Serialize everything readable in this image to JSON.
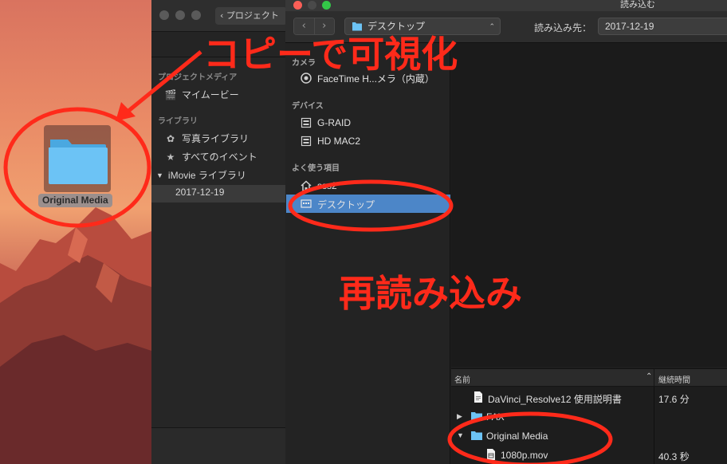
{
  "desktop": {
    "folder_label": "Original Media"
  },
  "imovie": {
    "back_button_label": "プロジェクト",
    "sections": [
      {
        "heading": "プロジェクトメディア",
        "items": [
          {
            "label": "マイムービー",
            "icon": "clapper-icon"
          }
        ]
      },
      {
        "heading": "ライブラリ",
        "items": [
          {
            "label": "写真ライブラリ",
            "icon": "photos-icon"
          },
          {
            "label": "すべてのイベント",
            "icon": "star-icon"
          }
        ]
      }
    ],
    "library_label": "iMovie ライブラリ",
    "event_label": "2017-12-19"
  },
  "dialog": {
    "title": "読み込む",
    "location": "デスクトップ",
    "import_to_label": "読み込み先：",
    "import_to_value": "2017-12-19",
    "sidebar": {
      "cameras_heading": "カメラ",
      "camera_item": "FaceTime H...メラ（内蔵）",
      "devices_heading": "デバイス",
      "devices": [
        "G-RAID",
        "HD MAC2"
      ],
      "favorites_heading": "よく使う項目",
      "favorites": [
        "sss2",
        "デスクトップ"
      ]
    },
    "file_list": {
      "col_name": "名前",
      "col_duration": "継続時間",
      "rows": [
        {
          "name": "DaVinci_Resolve12 使用説明書",
          "duration": "17.6 分",
          "kind": "doc"
        },
        {
          "name": "FAX",
          "duration": "",
          "kind": "folder"
        },
        {
          "name": "Original Media",
          "duration": "",
          "kind": "folder"
        },
        {
          "name": "1080p.mov",
          "duration": "40.3 秒",
          "kind": "movie"
        }
      ]
    }
  },
  "annotations": {
    "copy_text": "コピーで可視化",
    "reload_text": "再読み込み"
  },
  "colors": {
    "annotation_red": "#ff2a1a",
    "selection_blue": "#4c86c8",
    "folder_blue": "#6cc3f5"
  }
}
